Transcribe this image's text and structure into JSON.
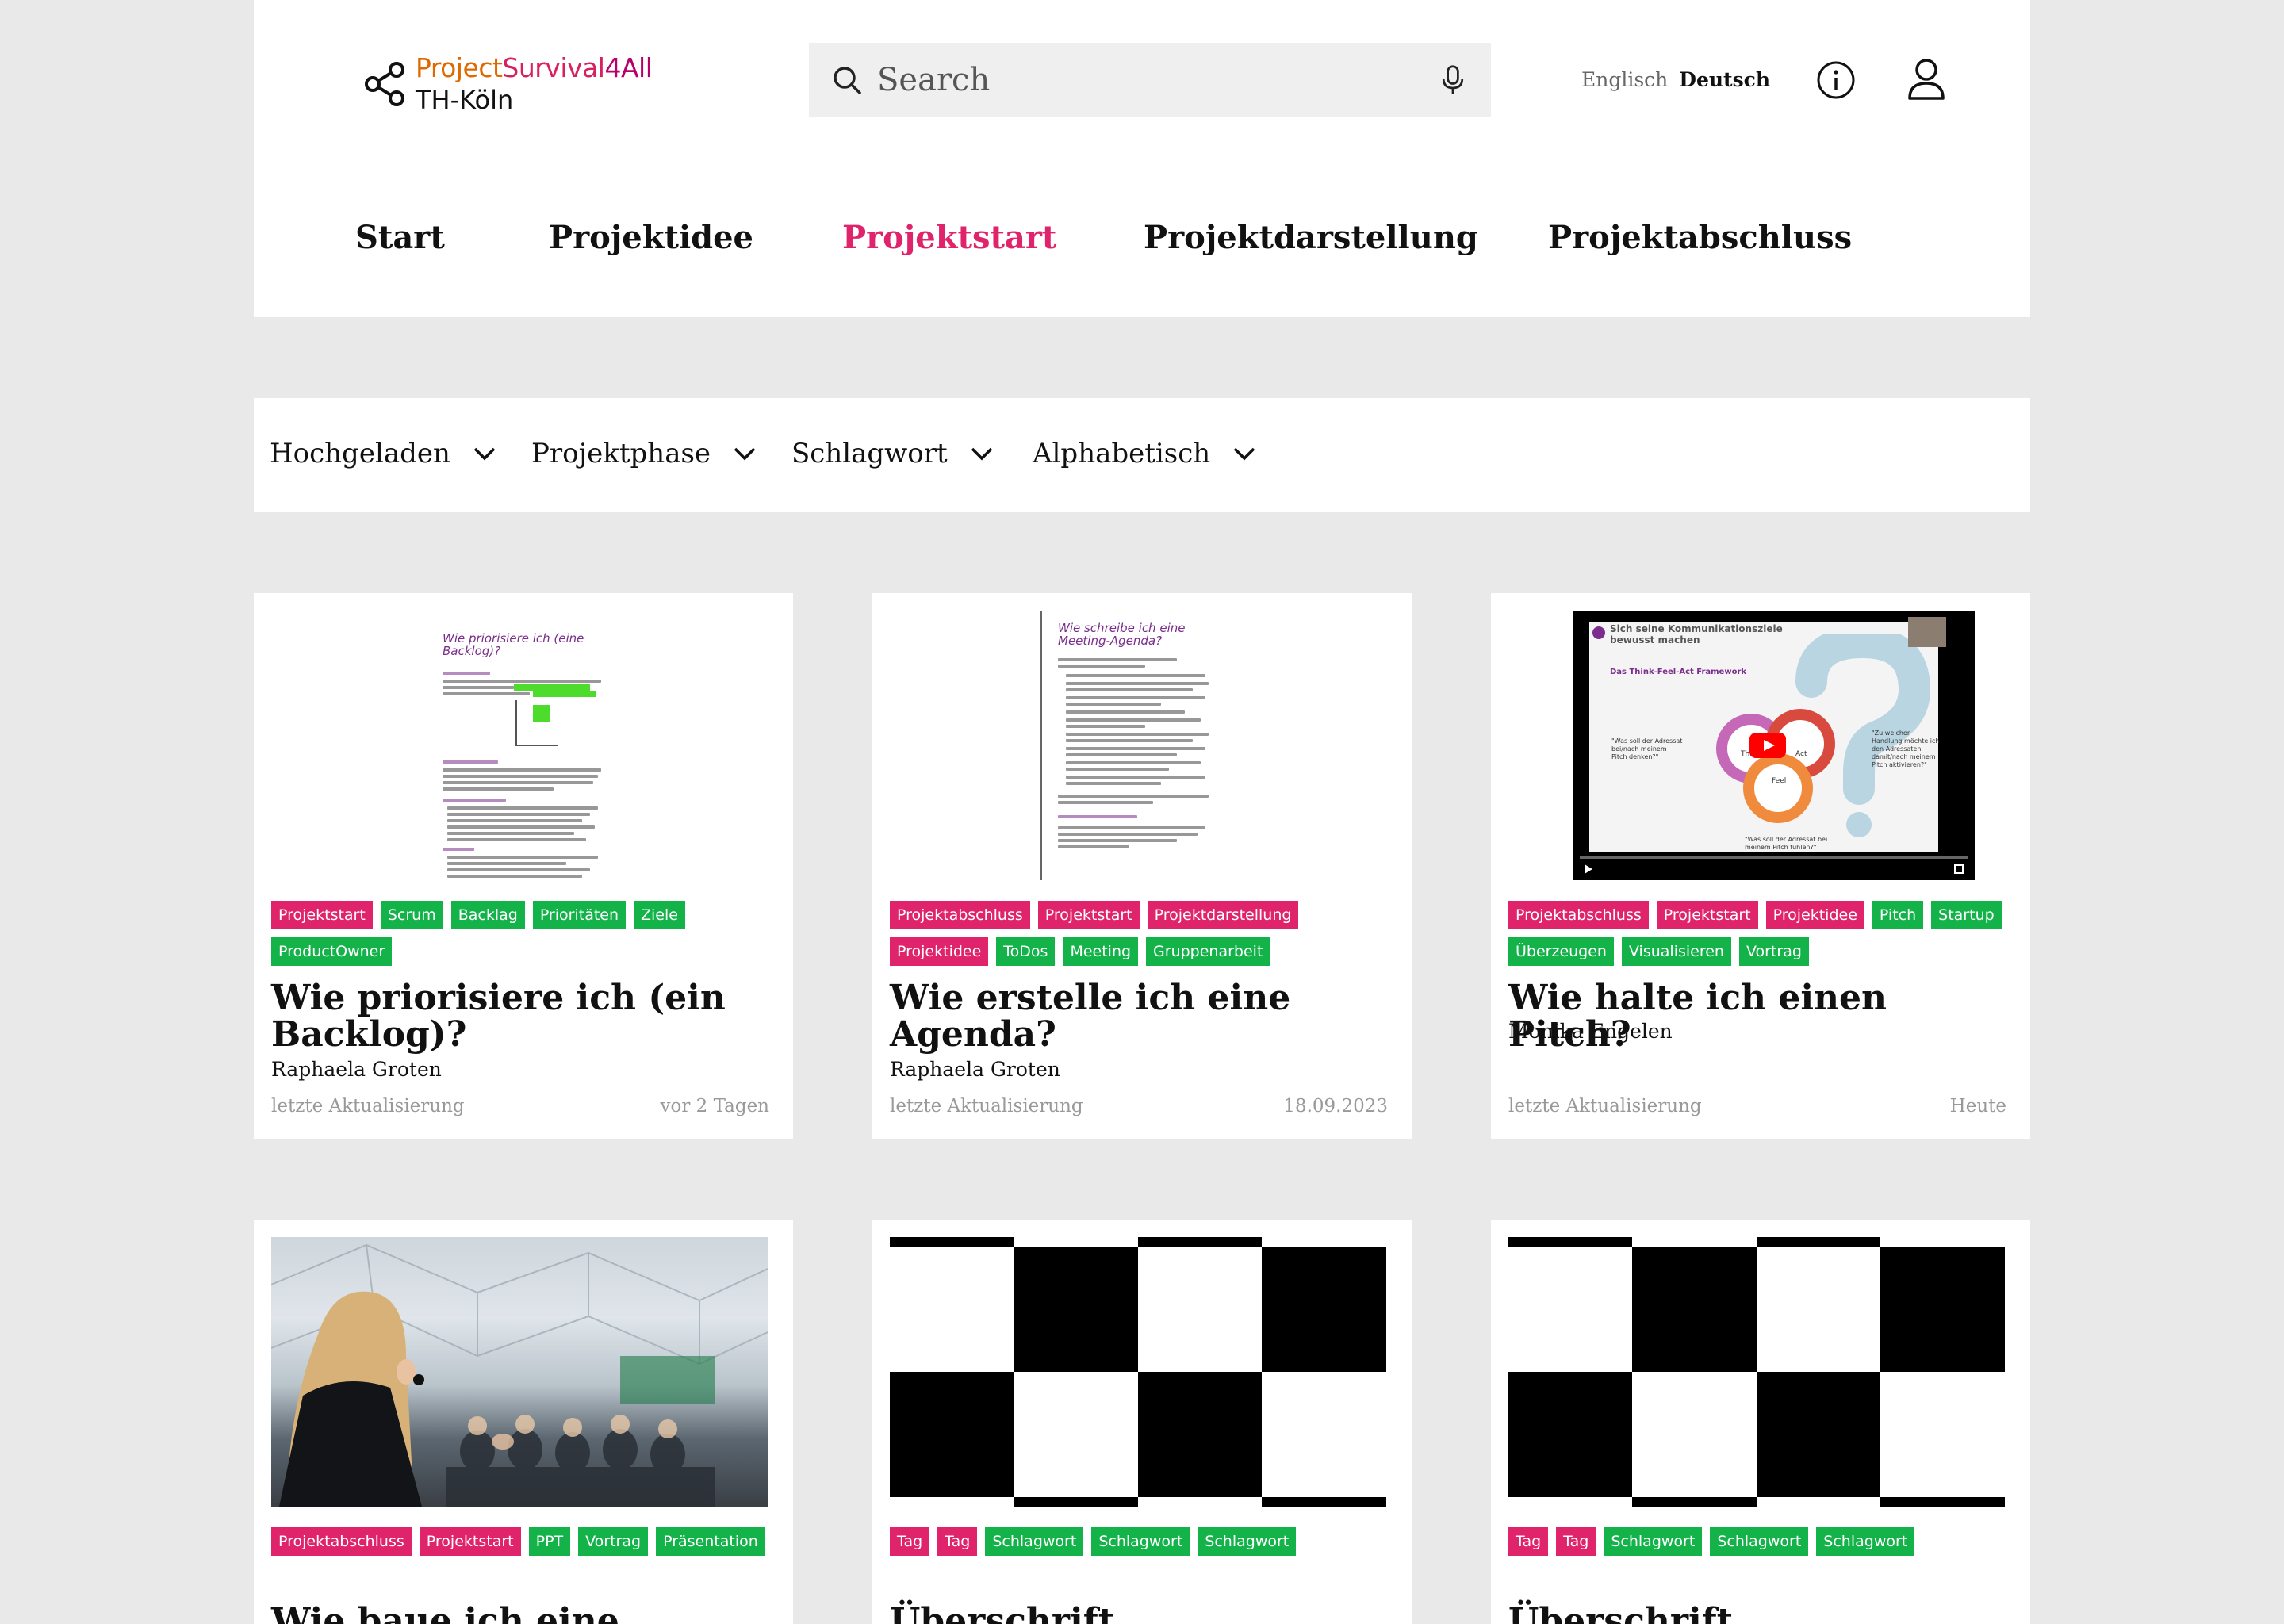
{
  "header": {
    "logo": {
      "line1_a": "Project",
      "line1_b": "Survival",
      "line1_c": "4All",
      "line2": "TH-Köln"
    },
    "search_placeholder": "Search",
    "lang_inactive": "Englisch",
    "lang_active": "Deutsch"
  },
  "nav": [
    "Start",
    "Projektidee",
    "Projektstart",
    "Projektdarstellung",
    "Projektabschluss"
  ],
  "filters": [
    "Hochgeladen",
    "Projektphase",
    "Schlagwort",
    "Alphabetisch"
  ],
  "colors": {
    "accent": "#e0246c",
    "tag_green": "#14b34a"
  },
  "cards": [
    {
      "doc_title": "Wie priorisiere ich (eine Backlog)?",
      "tags": [
        {
          "label": "Projektstart",
          "color": "pink"
        },
        {
          "label": "Scrum",
          "color": "green"
        },
        {
          "label": "Backlag",
          "color": "green"
        },
        {
          "label": "Prioritäten",
          "color": "green"
        },
        {
          "label": "Ziele",
          "color": "green"
        },
        {
          "label": "ProductOwner",
          "color": "green"
        }
      ],
      "title": "Wie priorisiere ich (ein Backlog)?",
      "author": "Raphaela Groten",
      "meta_label": "letzte Aktualisierung",
      "meta_value": "vor 2 Tagen"
    },
    {
      "doc_title": "Wie schreibe ich eine Meeting-Agenda?",
      "tags": [
        {
          "label": "Projektabschluss",
          "color": "pink"
        },
        {
          "label": "Projektstart",
          "color": "pink"
        },
        {
          "label": "Projektdarstellung",
          "color": "pink"
        },
        {
          "label": "Projektidee",
          "color": "pink"
        },
        {
          "label": "ToDos",
          "color": "green"
        },
        {
          "label": "Meeting",
          "color": "green"
        },
        {
          "label": "Gruppenarbeit",
          "color": "green"
        }
      ],
      "title": "Wie erstelle ich eine Agenda?",
      "author": "Raphaela Groten",
      "meta_label": "letzte Aktualisierung",
      "meta_value": "18.09.2023"
    },
    {
      "video": {
        "heading": "Sich seine Kommunikationsziele bewusst machen",
        "subheading": "Das Think-Feel-Act Framework",
        "left_text": "\"Was soll der Adressat bei/nach meinem Pitch denken?\"",
        "right_text": "\"Zu welcher Handlung möchte ich den Adressaten damit/nach meinem Pitch aktivieren?\"",
        "bottom_text": "\"Was soll der Adressat bei meinem Pitch fühlen?\"",
        "labels": [
          "Think",
          "Act",
          "Feel"
        ]
      },
      "tags": [
        {
          "label": "Projektabschluss",
          "color": "pink"
        },
        {
          "label": "Projektstart",
          "color": "pink"
        },
        {
          "label": "Projektidee",
          "color": "pink"
        },
        {
          "label": "Pitch",
          "color": "green"
        },
        {
          "label": "Startup",
          "color": "green"
        },
        {
          "label": "Überzeugen",
          "color": "green"
        },
        {
          "label": "Visualisieren",
          "color": "green"
        },
        {
          "label": "Vortrag",
          "color": "green"
        }
      ],
      "title": "Wie halte ich einen Pitch?",
      "author": "Monika Engelen",
      "meta_label": "letzte Aktualisierung",
      "meta_value": "Heute"
    },
    {
      "tags": [
        {
          "label": "Projektabschluss",
          "color": "pink"
        },
        {
          "label": "Projektstart",
          "color": "pink"
        },
        {
          "label": "PPT",
          "color": "green"
        },
        {
          "label": "Vortrag",
          "color": "green"
        },
        {
          "label": "Präsentation",
          "color": "green"
        }
      ],
      "title": "Wie baue ich eine"
    },
    {
      "tags": [
        {
          "label": "Tag",
          "color": "pink"
        },
        {
          "label": "Tag",
          "color": "pink"
        },
        {
          "label": "Schlagwort",
          "color": "green"
        },
        {
          "label": "Schlagwort",
          "color": "green"
        },
        {
          "label": "Schlagwort",
          "color": "green"
        }
      ],
      "title": "Überschrift"
    },
    {
      "tags": [
        {
          "label": "Tag",
          "color": "pink"
        },
        {
          "label": "Tag",
          "color": "pink"
        },
        {
          "label": "Schlagwort",
          "color": "green"
        },
        {
          "label": "Schlagwort",
          "color": "green"
        },
        {
          "label": "Schlagwort",
          "color": "green"
        }
      ],
      "title": "Überschrift"
    }
  ]
}
